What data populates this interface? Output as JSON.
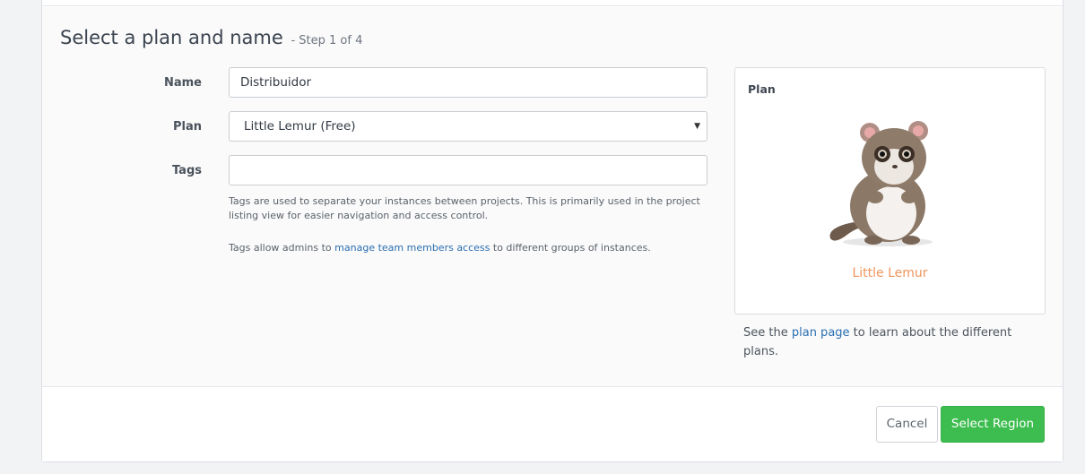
{
  "header": {
    "title": "Select a plan and name",
    "step": "- Step 1 of 4"
  },
  "form": {
    "name_label": "Name",
    "name_value": "Distribuidor",
    "plan_label": "Plan",
    "plan_selected": "Little Lemur (Free)",
    "tags_label": "Tags",
    "tags_value": "",
    "tags_help_1": "Tags are used to separate your instances between projects. This is primarily used in the project listing view for easier navigation and access control.",
    "tags_help_2_prefix": "Tags allow admins to ",
    "tags_help_2_link": "manage team members access",
    "tags_help_2_suffix": " to different groups of instances."
  },
  "plan_panel": {
    "heading": "Plan",
    "plan_name": "Little Lemur",
    "note_prefix": "See the ",
    "note_link": "plan page",
    "note_suffix": " to learn about the different plans.",
    "plan_name_color": "#f0955d"
  },
  "footer": {
    "cancel_label": "Cancel",
    "primary_label": "Select Region",
    "primary_color": "#3dbd4f"
  }
}
